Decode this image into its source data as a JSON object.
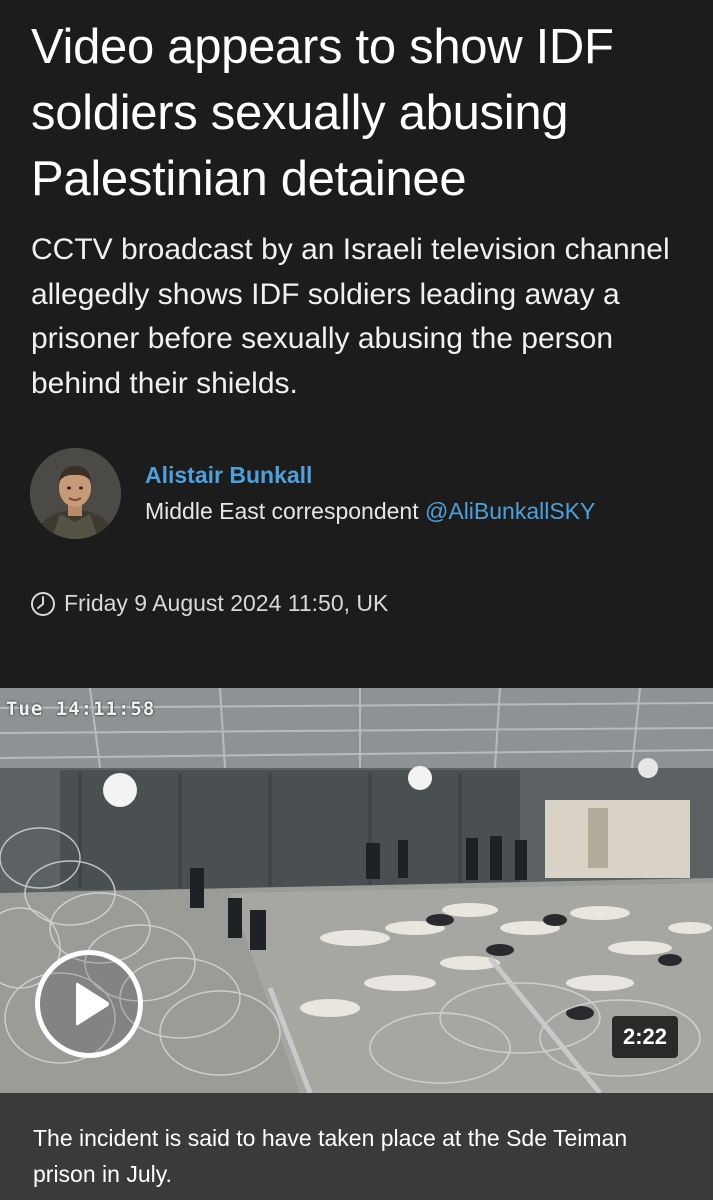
{
  "article": {
    "headline": "Video appears to show IDF soldiers sexually abusing Palestinian detainee",
    "standfirst": "CCTV broadcast by an Israeli television channel allegedly shows IDF soldiers leading away a prisoner before sexually abusing the person behind their shields."
  },
  "author": {
    "name": "Alistair Bunkall",
    "role": "Middle East correspondent",
    "handle": "@AliBunkallSKY"
  },
  "published": {
    "icon": "clock-icon",
    "text": "Friday 9 August 2024 11:50, UK"
  },
  "video": {
    "cctv_timestamp": "Tue 14:11:58",
    "duration": "2:22",
    "play_icon": "play-icon"
  },
  "caption": {
    "text": "The incident is said to have taken place at the Sde Teiman prison in July."
  },
  "colors": {
    "background": "#1c1c1c",
    "link_blue": "#4ea0dd",
    "caption_bar": "#3a3a3a"
  }
}
